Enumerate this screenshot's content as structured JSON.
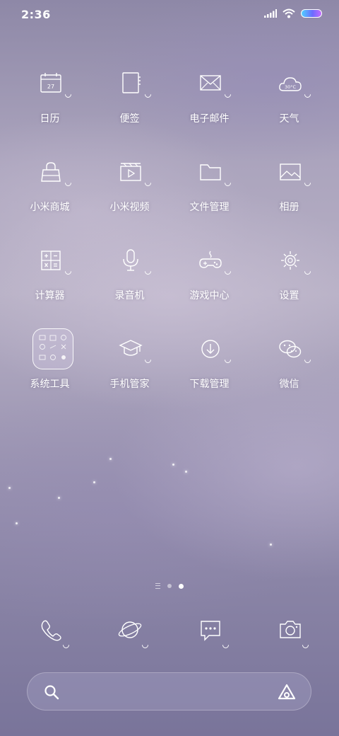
{
  "status_bar": {
    "time": "2:36"
  },
  "apps": [
    {
      "label": "日历",
      "icon": "calendar-icon",
      "date": "27"
    },
    {
      "label": "便签",
      "icon": "notes-icon"
    },
    {
      "label": "电子邮件",
      "icon": "mail-icon"
    },
    {
      "label": "天气",
      "icon": "weather-icon",
      "temp": "30°C"
    },
    {
      "label": "小米商城",
      "icon": "shopping-bag-icon"
    },
    {
      "label": "小米视频",
      "icon": "video-icon"
    },
    {
      "label": "文件管理",
      "icon": "folder-icon"
    },
    {
      "label": "相册",
      "icon": "gallery-icon"
    },
    {
      "label": "计算器",
      "icon": "calculator-icon"
    },
    {
      "label": "录音机",
      "icon": "microphone-icon"
    },
    {
      "label": "游戏中心",
      "icon": "gamepad-icon"
    },
    {
      "label": "设置",
      "icon": "gear-icon"
    },
    {
      "label": "系统工具",
      "icon": "folder-group-icon"
    },
    {
      "label": "手机管家",
      "icon": "security-icon"
    },
    {
      "label": "下载管理",
      "icon": "download-icon"
    },
    {
      "label": "微信",
      "icon": "wechat-icon"
    }
  ],
  "dock": [
    {
      "icon": "phone-icon"
    },
    {
      "icon": "browser-planet-icon"
    },
    {
      "icon": "messages-icon"
    },
    {
      "icon": "camera-icon"
    }
  ],
  "pager": {
    "pages": 3,
    "active_index": 2
  }
}
